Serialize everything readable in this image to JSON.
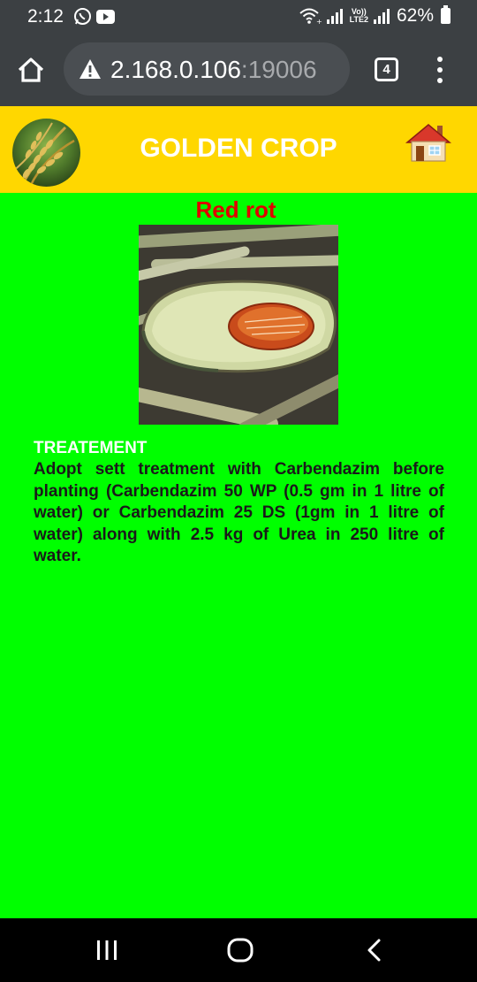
{
  "status_bar": {
    "time": "2:12",
    "lte_top": "Vo))",
    "lte_bottom": "LTE2",
    "battery": "62%",
    "icons": [
      "whatsapp-icon",
      "youtube-icon",
      "wifi-icon",
      "signal-icon",
      "battery-icon"
    ]
  },
  "browser": {
    "url_host": "2.168.0.106",
    "url_port": ":19006",
    "tab_count": "4",
    "icons": [
      "home-icon",
      "warning-icon",
      "more-icon"
    ]
  },
  "app": {
    "title": "GOLDEN CROP",
    "icons": [
      "rice-logo",
      "house-icon"
    ],
    "colors": {
      "header": "#ffd700",
      "page": "#00ff00",
      "title": "#e00000"
    }
  },
  "disease": {
    "name": "Red rot",
    "treatment_heading": "TREATEMENT",
    "treatment_text": "Adopt sett treatment with Carbendazim before planting (Carbendazim 50 WP (0.5 gm in 1 litre of water) or Carbendazim 25 DS (1gm in 1 litre of water) along with 2.5 kg of Urea in 250 litre of water."
  },
  "nav": {
    "icons": [
      "recent-apps-icon",
      "home-circle-icon",
      "back-icon"
    ]
  }
}
